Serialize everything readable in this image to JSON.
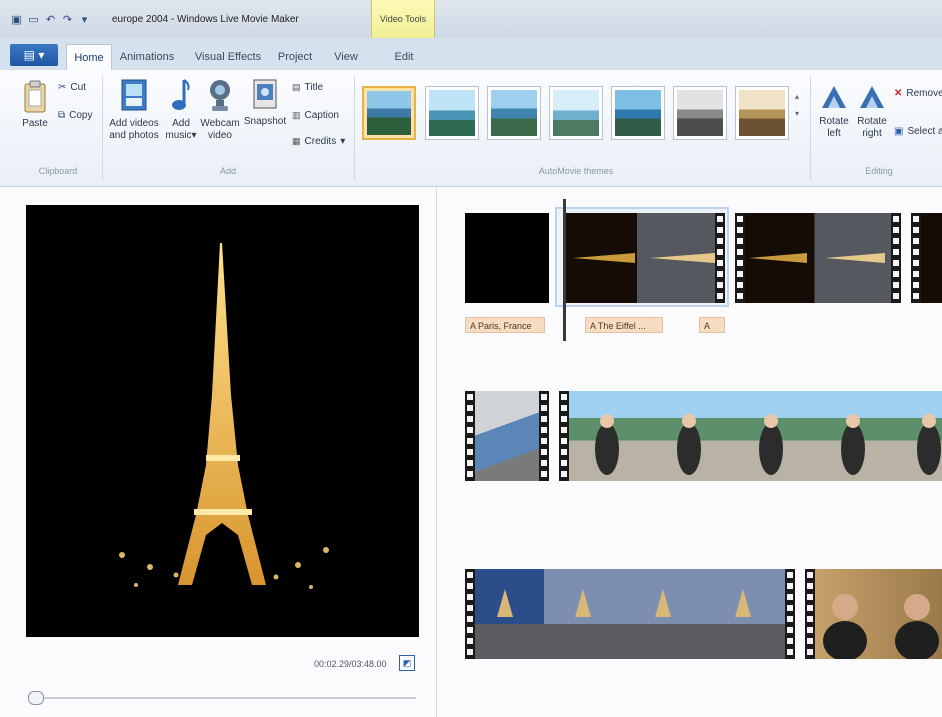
{
  "window": {
    "title": "europe 2004 - Windows Live Movie Maker",
    "contextual_tab_group": "Video Tools"
  },
  "quick_access": [
    "app-menu-icon",
    "save-icon",
    "undo-icon",
    "redo-icon",
    "customize-icon"
  ],
  "tabs": [
    {
      "label": "Home",
      "active": true
    },
    {
      "label": "Animations"
    },
    {
      "label": "Visual Effects"
    },
    {
      "label": "Project"
    },
    {
      "label": "View"
    },
    {
      "label": "Edit"
    }
  ],
  "file_button_label": "▾",
  "ribbon": {
    "clipboard": {
      "paste": "Paste",
      "cut": "Cut",
      "copy": "Copy",
      "group": "Clipboard"
    },
    "add": {
      "add_videos": "Add videos and photos",
      "add_music": "Add music",
      "webcam": "Webcam video",
      "snapshot": "Snapshot",
      "title": "Title",
      "caption": "Caption",
      "credits": "Credits",
      "group": "Add"
    },
    "autothemes_group": "AutoMovie themes",
    "editing": {
      "rotate_left": "Rotate left",
      "rotate_right": "Rotate right",
      "remove": "Remove",
      "select_all": "Select all",
      "group": "Editing"
    }
  },
  "preview": {
    "time": "00:02.29/03:48.00"
  },
  "storyboard": {
    "captions": [
      "A Paris, France",
      "A The Eiffel ...",
      "A"
    ]
  },
  "colors": {
    "file_button": "#1f57a3",
    "video_tools_tab": "#f2ef96",
    "selected_theme": "#e7b24a",
    "caption_bg": "#f7dcc2"
  }
}
